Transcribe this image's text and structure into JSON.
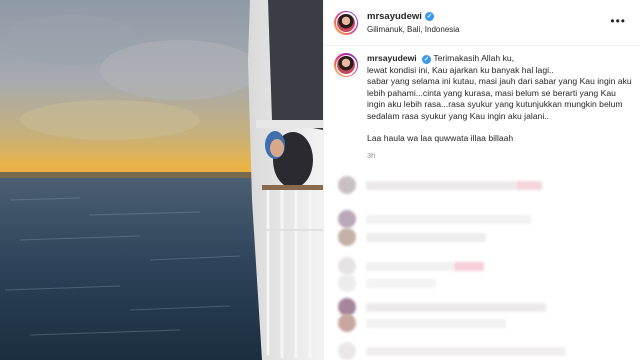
{
  "post": {
    "username": "mrsayudewi",
    "verified_mark": "✓",
    "location": "Gilimanuk, Bali, Indonesia",
    "more_label": "•••"
  },
  "caption": {
    "username": "mrsayudewi",
    "lines": [
      "Terimakasih Allah ku,",
      "lewat kondisi ini, Kau ajarkan ku banyak hal lagi..",
      "sabar yang selama ini kutau, masi jauh dari sabar yang Kau ingin aku lebih pahami...cinta yang kurasa, masi belum se berarti yang Kau ingin aku lebih rasa...rasa syukur yang kutunjukkan mungkin belum sedalam rasa syukur yang Kau ingin aku jalani..",
      "Laa haula wa laa quwwata illaa billaah"
    ],
    "time": "3h"
  },
  "colors": {
    "verified": "#3897f0",
    "muted": "#8e8e8e",
    "text": "#262626"
  }
}
